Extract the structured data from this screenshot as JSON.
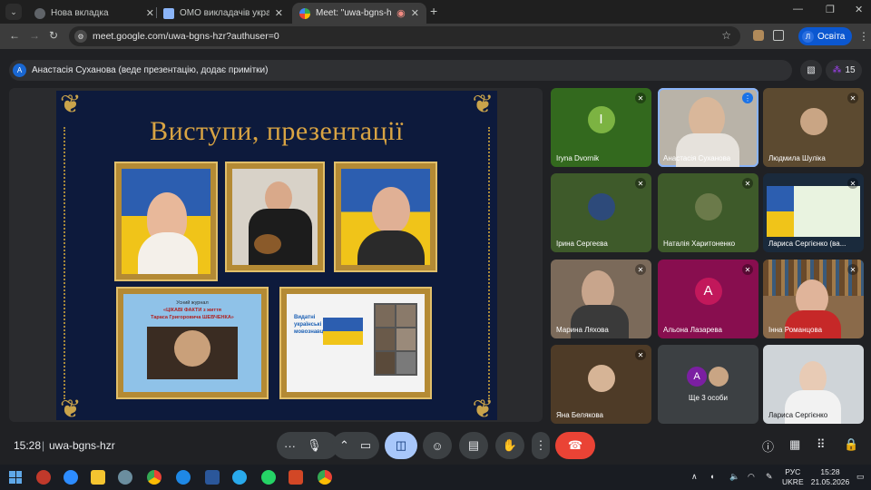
{
  "browser": {
    "tabs": [
      {
        "title": "Нова вкладка",
        "fav_color": "#5f6368"
      },
      {
        "title": "ОМО викладачів української",
        "fav_color": "#8ab4f8"
      },
      {
        "title": "Meet: \"uwa-bgns-hzr\"",
        "fav_color": "#34a853"
      }
    ],
    "url": "meet.google.com/uwa-bgns-hzr?authuser=0",
    "profile_label": "Освіта",
    "profile_initial": "Л"
  },
  "meet": {
    "presenter_initial": "А",
    "presenter_text": "Анастасія Суханова (веде презентацію, додає примітки)",
    "participants_count": "15",
    "slide_title": "Виступи, презентації",
    "slide_journal_lines": [
      "Усний журнал",
      "«ЦІКАВІ ФАКТИ з життя",
      "Тараса Григоровича ШЕВЧЕНКА»"
    ],
    "slide_box_lines": [
      "Видатні",
      "українські",
      "мовознавці"
    ],
    "tiles": [
      {
        "name": "Iryna Dvornik",
        "initial": "I",
        "bg": "#33691e",
        "badge": "#7cb342"
      },
      {
        "name": "Анастасія Суханова",
        "bg": "#b9b3a8"
      },
      {
        "name": "Людмила Шуліка",
        "bg": "#5c4a30"
      },
      {
        "name": "Ірина Сергеєва",
        "bg": "#3e5a2a"
      },
      {
        "name": "Наталія Харитоненко",
        "bg": "#3e5a2a"
      },
      {
        "name": "Лариса Сергієнко (ва...",
        "bg": "#1a2a3c"
      },
      {
        "name": "Марина Ляхова",
        "bg": "#7b6a5a"
      },
      {
        "name": "Альона Лазарева",
        "initial": "А",
        "bg": "#880e4f",
        "badge": "#c2185b"
      },
      {
        "name": "Інна Романцова",
        "bg": "#8a6a4a"
      },
      {
        "name": "Яна Белякова",
        "bg": "#4e3b27"
      },
      {
        "name": "Ще 3 особи",
        "initial": "А",
        "bg": "#3c4043",
        "badge": "#7b1fa2"
      },
      {
        "name": "Лариса Сергієнко",
        "bg": "#cfd4d8"
      }
    ]
  },
  "controls": {
    "time": "15:28",
    "separator": "|",
    "meeting_code": "uwa-bgns-hzr"
  },
  "taskbar": {
    "lang_top": "РУС",
    "lang_bottom": "UKRE",
    "time": "15:28",
    "date": "21.05.2026"
  }
}
